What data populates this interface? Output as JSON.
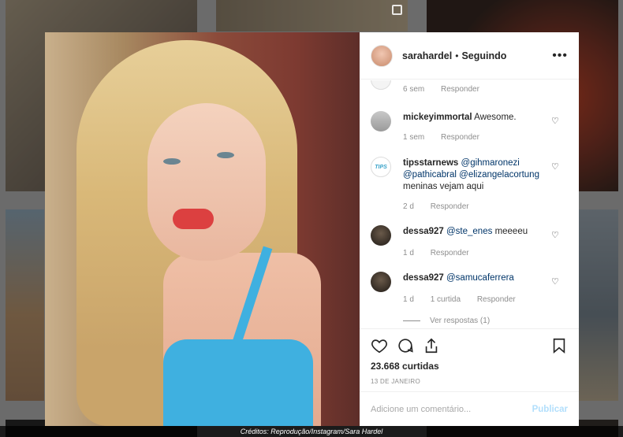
{
  "header": {
    "username": "sarahardel",
    "separator": "•",
    "follow_label": "Seguindo",
    "more_icon": "more-horizontal-icon"
  },
  "previous_comment": {
    "time": "6 sem",
    "reply": "Responder"
  },
  "comments": [
    {
      "user": "mickeyimmortal",
      "text": "Awesome.",
      "time": "1 sem",
      "reply": "Responder"
    },
    {
      "user": "tipsstarnews",
      "mentions": [
        "@gihmaronezi",
        "@pathicabral",
        "@elizangelacortung"
      ],
      "text": "meninas vejam aqui",
      "time": "2 d",
      "reply": "Responder",
      "avatar_text": "TIPS"
    },
    {
      "user": "dessa927",
      "mention": "@ste_enes",
      "text": "meeeeu",
      "time": "1 d",
      "reply": "Responder"
    },
    {
      "user": "dessa927",
      "mention": "@samucaferrera",
      "text": "",
      "time": "1 d",
      "likes": "1 curtida",
      "reply": "Responder"
    }
  ],
  "view_replies": "Ver respostas (1)",
  "actions": {
    "likes": "23.668 curtidas",
    "date": "13 DE JANEIRO"
  },
  "add_comment": {
    "placeholder": "Adicione um comentário...",
    "publish": "Publicar"
  },
  "credits": "Créditos: Reprodução/Instagram/Sara Hardel",
  "colors": {
    "mention": "#003569",
    "muted": "#8e8e8e",
    "publish": "#b2dffc",
    "top_color": "#3fb0e0"
  }
}
